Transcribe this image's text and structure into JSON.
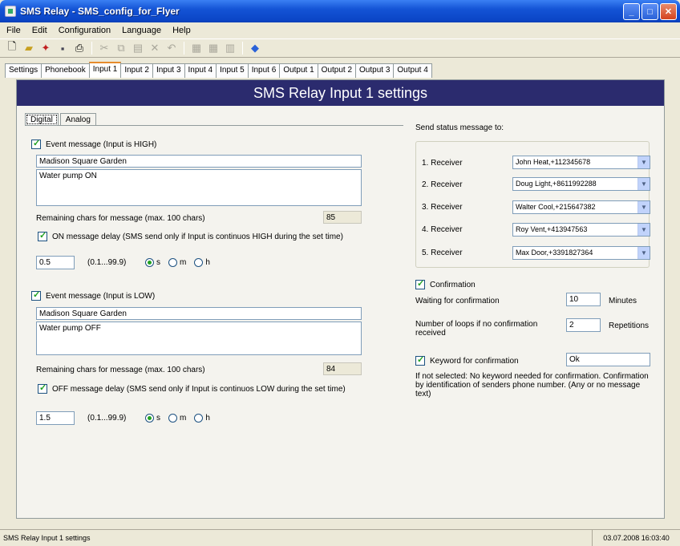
{
  "window": {
    "title": "SMS Relay - SMS_config_for_Flyer"
  },
  "menu": [
    "File",
    "Edit",
    "Configuration",
    "Language",
    "Help"
  ],
  "toolbar_icons": [
    "new-icon",
    "open-icon",
    "wizard-icon",
    "save-icon",
    "print-icon",
    "cut-icon",
    "copy-icon",
    "paste-icon",
    "delete-icon",
    "undo-icon",
    "grid-icon",
    "grid2-icon",
    "chart-icon",
    "help-icon"
  ],
  "tabs": [
    "Settings",
    "Phonebook",
    "Input 1",
    "Input 2",
    "Input 3",
    "Input 4",
    "Input 5",
    "Input 6",
    "Output 1",
    "Output 2",
    "Output 3",
    "Output 4"
  ],
  "banner": "SMS Relay Input 1 settings",
  "subtabs": [
    "Digital",
    "Analog"
  ],
  "high": {
    "event_label": "Event message (Input is HIGH)",
    "line1": "Madison Square Garden",
    "line2": "Water pump ON",
    "remaining_label": "Remaining chars for message  (max. 100 chars)",
    "remaining": "85",
    "delay_label": "ON message delay (SMS send only if Input is continuos HIGH during the set time)",
    "delay_value": "0.5",
    "range": "(0.1...99.9)",
    "unit_s": "s",
    "unit_m": "m",
    "unit_h": "h"
  },
  "low": {
    "event_label": "Event message (Input is LOW)",
    "line1": "Madison Square Garden",
    "line2": "Water pump OFF",
    "remaining_label": "Remaining chars for message  (max. 100 chars)",
    "remaining": "84",
    "delay_label": "OFF message delay (SMS send only if Input is continuos  LOW during the set time)",
    "delay_value": "1.5",
    "range": "(0.1...99.9)",
    "unit_s": "s",
    "unit_m": "m",
    "unit_h": "h"
  },
  "status": {
    "send_to_label": "Send status message to:",
    "receivers": [
      {
        "label": "1. Receiver",
        "value": "John Heat,+112345678"
      },
      {
        "label": "2. Receiver",
        "value": "Doug Light,+8611992288"
      },
      {
        "label": "3. Receiver",
        "value": "Walter Cool,+215647382"
      },
      {
        "label": "4. Receiver",
        "value": "Roy Vent,+413947563"
      },
      {
        "label": "5. Receiver",
        "value": "Max Door,+3391827364"
      }
    ]
  },
  "confirmation": {
    "label": "Confirmation",
    "waiting_label": "Waiting for confirmation",
    "waiting_value": "10",
    "waiting_unit": "Minutes",
    "loops_label": "Number of loops if no confirmation received",
    "loops_value": "2",
    "loops_unit": "Repetitions",
    "keyword_label": "Keyword for confirmation",
    "keyword_value": "Ok",
    "note": "If not selected: No keyword needed for confirmation.  Confirmation by identification of senders phone number. (Any or no message text)"
  },
  "statusbar": {
    "left": "SMS Relay Input 1 settings",
    "right": "03.07.2008 16:03:40"
  }
}
